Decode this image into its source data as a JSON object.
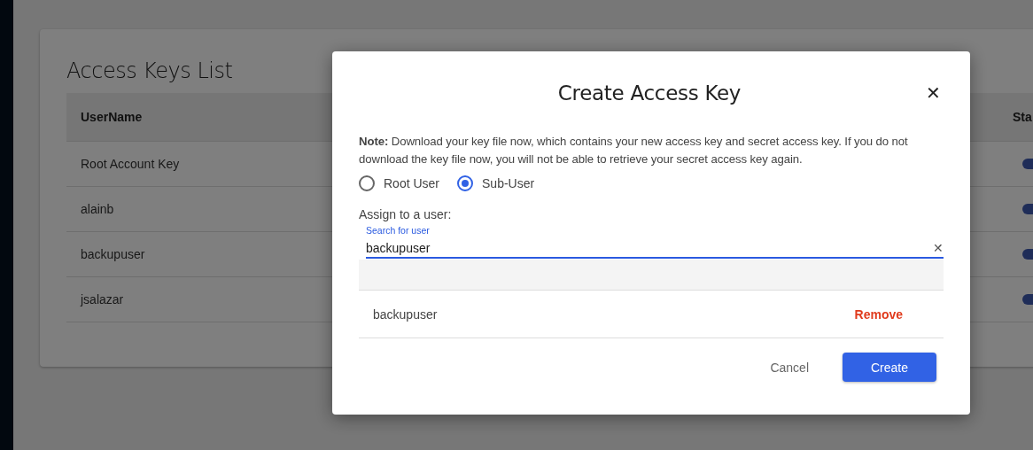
{
  "page": {
    "title": "Access Keys List",
    "table": {
      "columns": [
        "UserName",
        "Sta"
      ],
      "rows": [
        {
          "username": "Root Account Key",
          "status_on": true
        },
        {
          "username": "alainb",
          "status_on": true
        },
        {
          "username": "backupuser",
          "status_on": true
        },
        {
          "username": "jsalazar",
          "status_on": true
        }
      ]
    }
  },
  "dialog": {
    "title": "Create Access Key",
    "close": "✕",
    "note_label": "Note:",
    "note": "Download your key file now, which contains your new access key and secret access key. If you do not download the key file now, you will not be able to retrieve your secret access key again.",
    "user_types": [
      {
        "label": "Root User",
        "selected": false
      },
      {
        "label": "Sub-User",
        "selected": true
      }
    ],
    "assign_label": "Assign to a user:",
    "search": {
      "label": "Search for user",
      "value": "backupuser",
      "clear": "✕"
    },
    "assigned": [
      {
        "name": "backupuser",
        "action": "Remove"
      }
    ],
    "buttons": [
      {
        "label": "Cancel",
        "kind": "text"
      },
      {
        "label": "Create",
        "kind": "primary"
      }
    ]
  }
}
